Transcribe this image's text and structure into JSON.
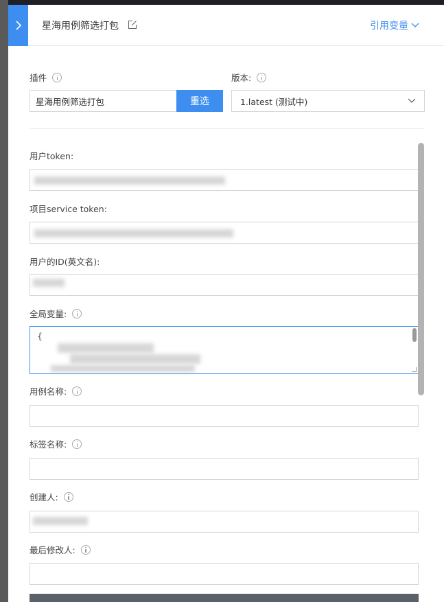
{
  "header": {
    "title": "星海用例筛选打包",
    "ref_var_label": "引用变量",
    "expand_icon": "chevron-right-icon",
    "edit_icon": "edit-icon"
  },
  "plugin": {
    "label": "插件",
    "value": "星海用例筛选打包",
    "reselect_label": "重选"
  },
  "version": {
    "label": "版本:",
    "value": "1.latest (测试中)"
  },
  "fields": {
    "user_token_label": "用户token:",
    "service_token_label": "项目service token:",
    "user_id_label": "用户的ID(英文名):",
    "global_vars_label": "全局变量:",
    "global_vars_first_char": "{",
    "case_name_label": "用例名称:",
    "tag_name_label": "标签名称:",
    "creator_label": "创建人:",
    "last_modifier_label": "最后修改人:"
  },
  "colors": {
    "accent": "#3d8ef0",
    "border": "#d6d6d6",
    "text": "#333333"
  }
}
